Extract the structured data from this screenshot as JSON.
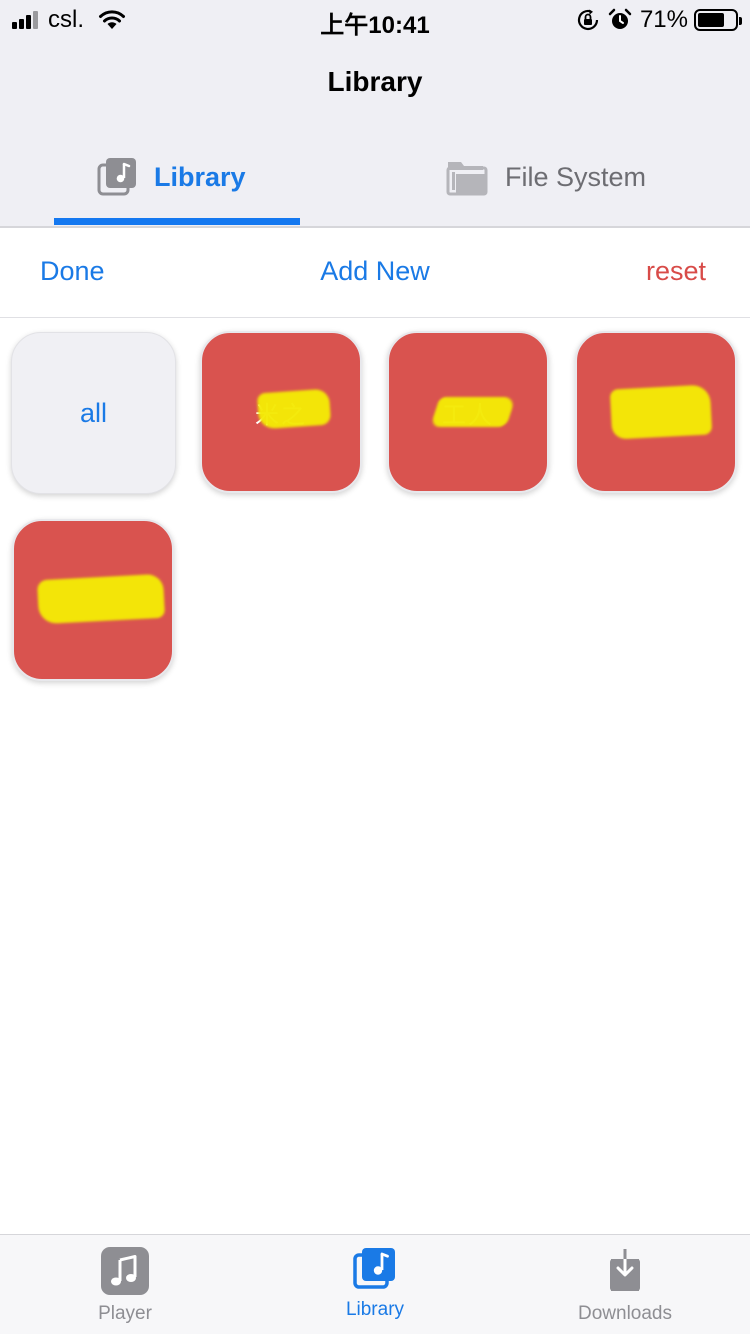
{
  "status_bar": {
    "carrier": "csl.",
    "time": "上午10:41",
    "battery_percent": "71%",
    "battery_level": 0.71,
    "icons": [
      "signal-icon",
      "wifi-icon",
      "orientation-lock-icon",
      "alarm-icon",
      "battery-icon"
    ]
  },
  "nav": {
    "title": "Library"
  },
  "segments": {
    "library_label": "Library",
    "files_label": "File System",
    "selected": "Library"
  },
  "actions": {
    "done_label": "Done",
    "add_label": "Add New",
    "reset_label": "reset"
  },
  "tiles": [
    {
      "label": "all"
    },
    {
      "label": "米之"
    },
    {
      "label": "工人"
    },
    {
      "label": ""
    },
    {
      "label": ""
    }
  ],
  "tab_bar": {
    "player_label": "Player",
    "library_label": "Library",
    "downloads_label": "Downloads",
    "selected": "Library"
  },
  "colors": {
    "accent": "#1a7ae6",
    "destructive": "#d84b48",
    "tile_red": "#d9534f",
    "redaction_yellow": "#f4ea06",
    "chrome_background": "#efeff4"
  }
}
